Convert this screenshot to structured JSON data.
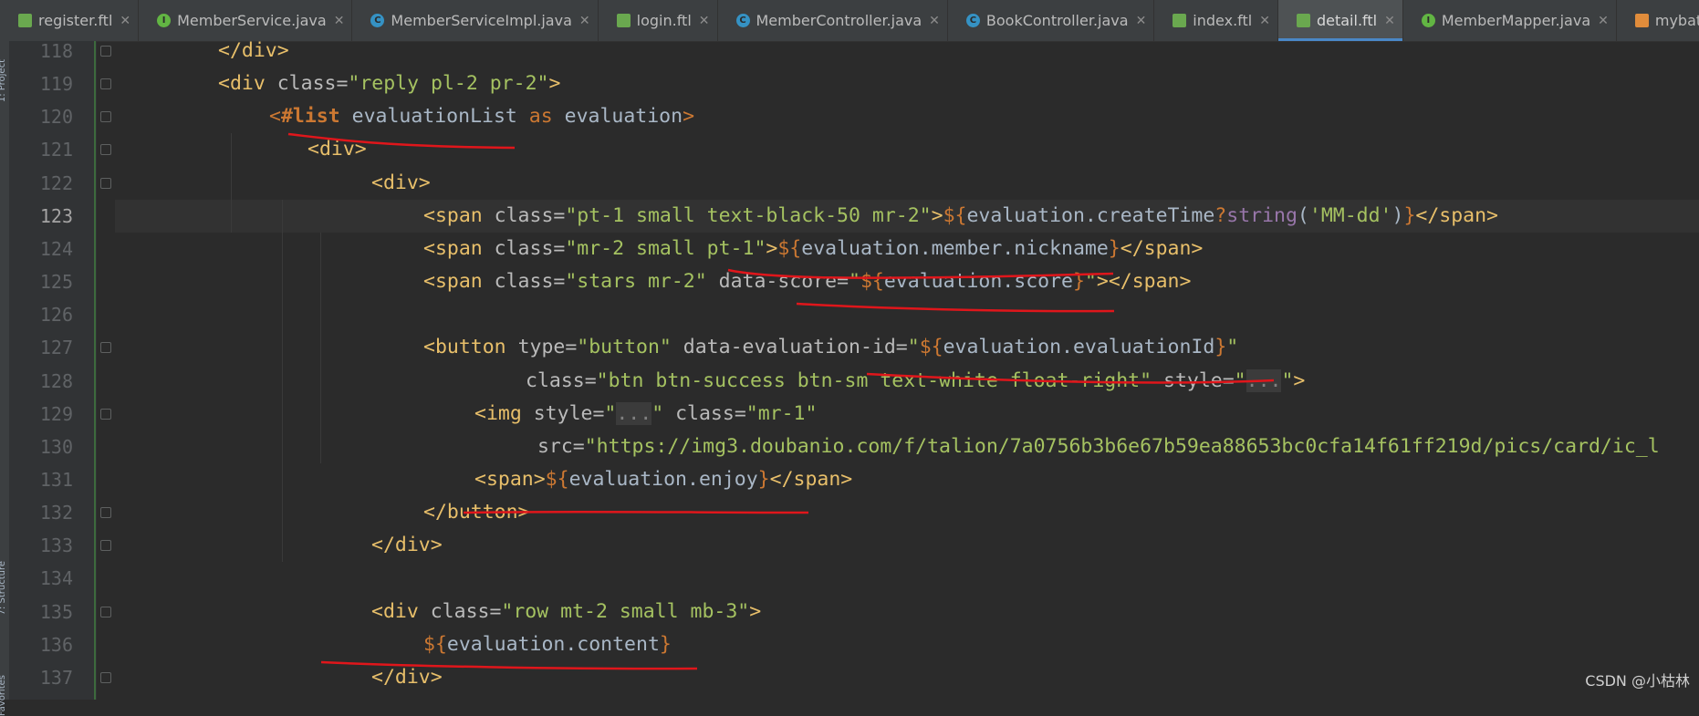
{
  "tabs": [
    {
      "name": "register.ftl",
      "type": "ftl",
      "active": false
    },
    {
      "name": "MemberService.java",
      "type": "interface",
      "active": false
    },
    {
      "name": "MemberServiceImpl.java",
      "type": "class",
      "active": false
    },
    {
      "name": "login.ftl",
      "type": "ftl",
      "active": false
    },
    {
      "name": "MemberController.java",
      "type": "class",
      "active": false
    },
    {
      "name": "BookController.java",
      "type": "class",
      "active": false
    },
    {
      "name": "index.ftl",
      "type": "ftl",
      "active": false
    },
    {
      "name": "detail.ftl",
      "type": "ftl",
      "active": true
    },
    {
      "name": "MemberMapper.java",
      "type": "interface",
      "active": false
    },
    {
      "name": "mybatis-config.xml",
      "type": "xml",
      "active": false
    }
  ],
  "side_labels": {
    "project": "1: Project",
    "structure": "7: Structure",
    "favorites": "Favorites"
  },
  "current_line": 123,
  "lines": [
    {
      "num": 118,
      "indent": 1,
      "tokens": [
        [
          "tag",
          "</div>"
        ]
      ]
    },
    {
      "num": 119,
      "indent": 1,
      "tokens": [
        [
          "tag",
          "<div "
        ],
        [
          "attr",
          "class="
        ],
        [
          "str",
          "\"reply pl-2 pr-2\""
        ],
        [
          "tag",
          ">"
        ]
      ]
    },
    {
      "num": 120,
      "indent": 2,
      "tokens": [
        [
          "op",
          "<"
        ],
        [
          "kw",
          "#list"
        ],
        [
          "plain",
          " evaluationList "
        ],
        [
          "op",
          "as"
        ],
        [
          "plain",
          " evaluation"
        ],
        [
          "op",
          ">"
        ]
      ]
    },
    {
      "num": 121,
      "indent": 3,
      "tokens": [
        [
          "tag",
          "<div>"
        ]
      ]
    },
    {
      "num": 122,
      "indent": 4,
      "tokens": [
        [
          "tag",
          "<div>"
        ]
      ]
    },
    {
      "num": 123,
      "indent": 5,
      "tokens": [
        [
          "tag",
          "<span "
        ],
        [
          "attr",
          "class="
        ],
        [
          "str",
          "\"pt-1 small text-black-50 mr-2\""
        ],
        [
          "tag",
          ">"
        ],
        [
          "op",
          "${"
        ],
        [
          "plain",
          "evaluation.createTime"
        ],
        [
          "op",
          "?"
        ],
        [
          "fn",
          "string"
        ],
        [
          "plain",
          "("
        ],
        [
          "str",
          "'MM-dd'"
        ],
        [
          "plain",
          ")"
        ],
        [
          "op",
          "}"
        ],
        [
          "tag",
          "</span>"
        ]
      ]
    },
    {
      "num": 124,
      "indent": 5,
      "tokens": [
        [
          "tag",
          "<span "
        ],
        [
          "attr",
          "class="
        ],
        [
          "str",
          "\"mr-2 small pt-1\""
        ],
        [
          "tag",
          ">"
        ],
        [
          "op",
          "${"
        ],
        [
          "plain",
          "evaluation.member.nickname"
        ],
        [
          "op",
          "}"
        ],
        [
          "tag",
          "</span>"
        ]
      ]
    },
    {
      "num": 125,
      "indent": 5,
      "tokens": [
        [
          "tag",
          "<span "
        ],
        [
          "attr",
          "class="
        ],
        [
          "str",
          "\"stars mr-2\" "
        ],
        [
          "attr",
          "data-score="
        ],
        [
          "str",
          "\""
        ],
        [
          "op",
          "${"
        ],
        [
          "plain",
          "evaluation.score"
        ],
        [
          "op",
          "}"
        ],
        [
          "str",
          "\""
        ],
        [
          "tag",
          "></span>"
        ]
      ]
    },
    {
      "num": 126,
      "indent": 0,
      "tokens": []
    },
    {
      "num": 127,
      "indent": 5,
      "tokens": [
        [
          "tag",
          "<button "
        ],
        [
          "attr",
          "type="
        ],
        [
          "str",
          "\"button\" "
        ],
        [
          "attr",
          "data-evaluation-id="
        ],
        [
          "str",
          "\""
        ],
        [
          "op",
          "${"
        ],
        [
          "plain",
          "evaluation.evaluationId"
        ],
        [
          "op",
          "}"
        ],
        [
          "str",
          "\""
        ]
      ]
    },
    {
      "num": 128,
      "indent": 7,
      "tokens": [
        [
          "attr",
          "class="
        ],
        [
          "str",
          "\"btn btn-success btn-sm text-white float-right\" "
        ],
        [
          "attr",
          "style="
        ],
        [
          "str",
          "\""
        ],
        [
          "fold",
          "..."
        ],
        [
          "str",
          "\""
        ],
        [
          "tag",
          ">"
        ]
      ]
    },
    {
      "num": 129,
      "indent": 6,
      "tokens": [
        [
          "tag",
          "<img "
        ],
        [
          "attr",
          "style="
        ],
        [
          "str",
          "\""
        ],
        [
          "fold",
          "..."
        ],
        [
          "str",
          "\" "
        ],
        [
          "attr",
          "class="
        ],
        [
          "str",
          "\"mr-1\""
        ]
      ]
    },
    {
      "num": 130,
      "indent": 7,
      "tokens": [
        [
          "attr",
          " src="
        ],
        [
          "str",
          "\"https://img3.doubanio.com/f/talion/7a0756b3b6e67b59ea88653bc0cfa14f61ff219d/pics/card/ic_l"
        ]
      ]
    },
    {
      "num": 131,
      "indent": 6,
      "tokens": [
        [
          "tag",
          "<span>"
        ],
        [
          "op",
          "${"
        ],
        [
          "plain",
          "evaluation.enjoy"
        ],
        [
          "op",
          "}"
        ],
        [
          "tag",
          "</span>"
        ]
      ]
    },
    {
      "num": 132,
      "indent": 5,
      "tokens": [
        [
          "tag",
          "</button>"
        ]
      ]
    },
    {
      "num": 133,
      "indent": 4,
      "tokens": [
        [
          "tag",
          "</div>"
        ]
      ]
    },
    {
      "num": 134,
      "indent": 0,
      "tokens": []
    },
    {
      "num": 135,
      "indent": 4,
      "tokens": [
        [
          "tag",
          "<div "
        ],
        [
          "attr",
          "class="
        ],
        [
          "str",
          "\"row mt-2 small mb-3\""
        ],
        [
          "tag",
          ">"
        ]
      ]
    },
    {
      "num": 136,
      "indent": 5,
      "tokens": [
        [
          "op",
          "${"
        ],
        [
          "plain",
          "evaluation.content"
        ],
        [
          "op",
          "}"
        ]
      ]
    },
    {
      "num": 137,
      "indent": 4,
      "tokens": [
        [
          "tag",
          "</div>"
        ]
      ]
    }
  ],
  "watermark": "CSDN @小枯林",
  "colors": {
    "editor_bg": "#2b2b2b",
    "tag": "#e8bf6a",
    "string": "#a5c261",
    "keyword": "#cc7832",
    "annotation_red": "#e0161b"
  }
}
